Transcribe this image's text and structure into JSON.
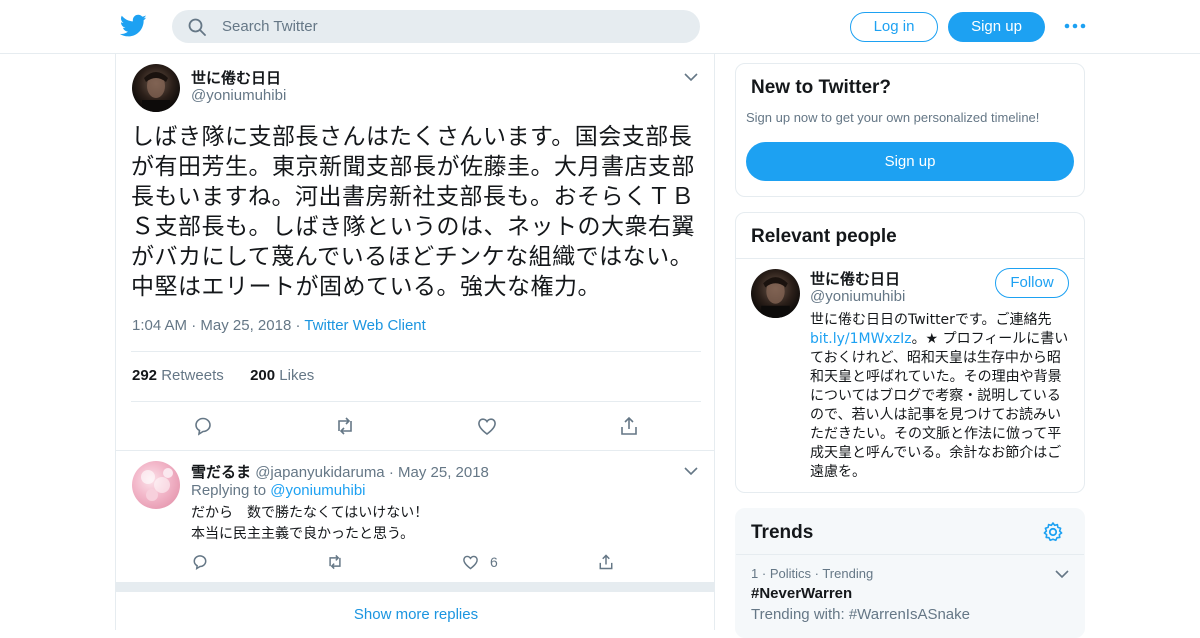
{
  "colors": {
    "accent": "#1da1f2",
    "link": "#1b95e0",
    "muted": "#657786",
    "border": "#e6ecf0"
  },
  "header": {
    "logo_icon": "twitter-bird-icon",
    "search_placeholder": "Search Twitter",
    "login_label": "Log in",
    "signup_label": "Sign up",
    "more_icon": "more-dots-icon"
  },
  "tweet": {
    "author_name": "世に倦む日日",
    "author_handle": "@yoniumuhibi",
    "text": "しばき隊に支部長さんはたくさんいます。国会支部長が有田芳生。東京新聞支部長が佐藤圭。大月書店支部長もいますね。河出書房新社支部長も。おそらくＴＢＳ支部長も。しばき隊というのは、ネットの大衆右翼がバカにして蔑んでいるほどチンケな組織ではない。中堅はエリートが固めている。強大な権力。",
    "time": "1:04 AM",
    "date": "May 25, 2018",
    "client": "Twitter Web Client",
    "retweets": "292",
    "retweets_label": "Retweets",
    "likes": "200",
    "likes_label": "Likes"
  },
  "reply": {
    "author_name": "雪だるま",
    "author_handle": "@japanyukidaruma",
    "date": "May 25, 2018",
    "replying_to_label": "Replying to",
    "replying_to_handle": "@yoniumuhibi",
    "line1": "だから　数で勝たなくてはいけない！",
    "line2": "本当に民主主義で良かったと思う。",
    "like_count": "6"
  },
  "show_more_replies": "Show more replies",
  "new_to_twitter": {
    "title": "New to Twitter?",
    "subtitle": "Sign up now to get your own personalized timeline!",
    "signup_label": "Sign up"
  },
  "relevant_people": {
    "title": "Relevant people",
    "name": "世に倦む日日",
    "handle": "@yoniumuhibi",
    "follow_label": "Follow",
    "bio_before_link": "世に倦む日日のTwitterです。ご連絡先",
    "bio_link": "bit.ly/1MWxzIz",
    "bio_after_link": "。★ プロフィールに書いておくけれど、昭和天皇は生存中から昭和天皇と呼ばれていた。その理由や背景についてはブログで考察・説明しているので、若い人は記事を見つけてお読みいただきたい。その文脈と作法に倣って平成天皇と呼んでいる。余計なお節介はご遠慮を。"
  },
  "trends": {
    "title": "Trends",
    "items": [
      {
        "rank": "1",
        "category": "Politics",
        "status": "Trending",
        "tag": "#NeverWarren",
        "trending_with": "Trending with: #WarrenIsASnake"
      }
    ]
  }
}
